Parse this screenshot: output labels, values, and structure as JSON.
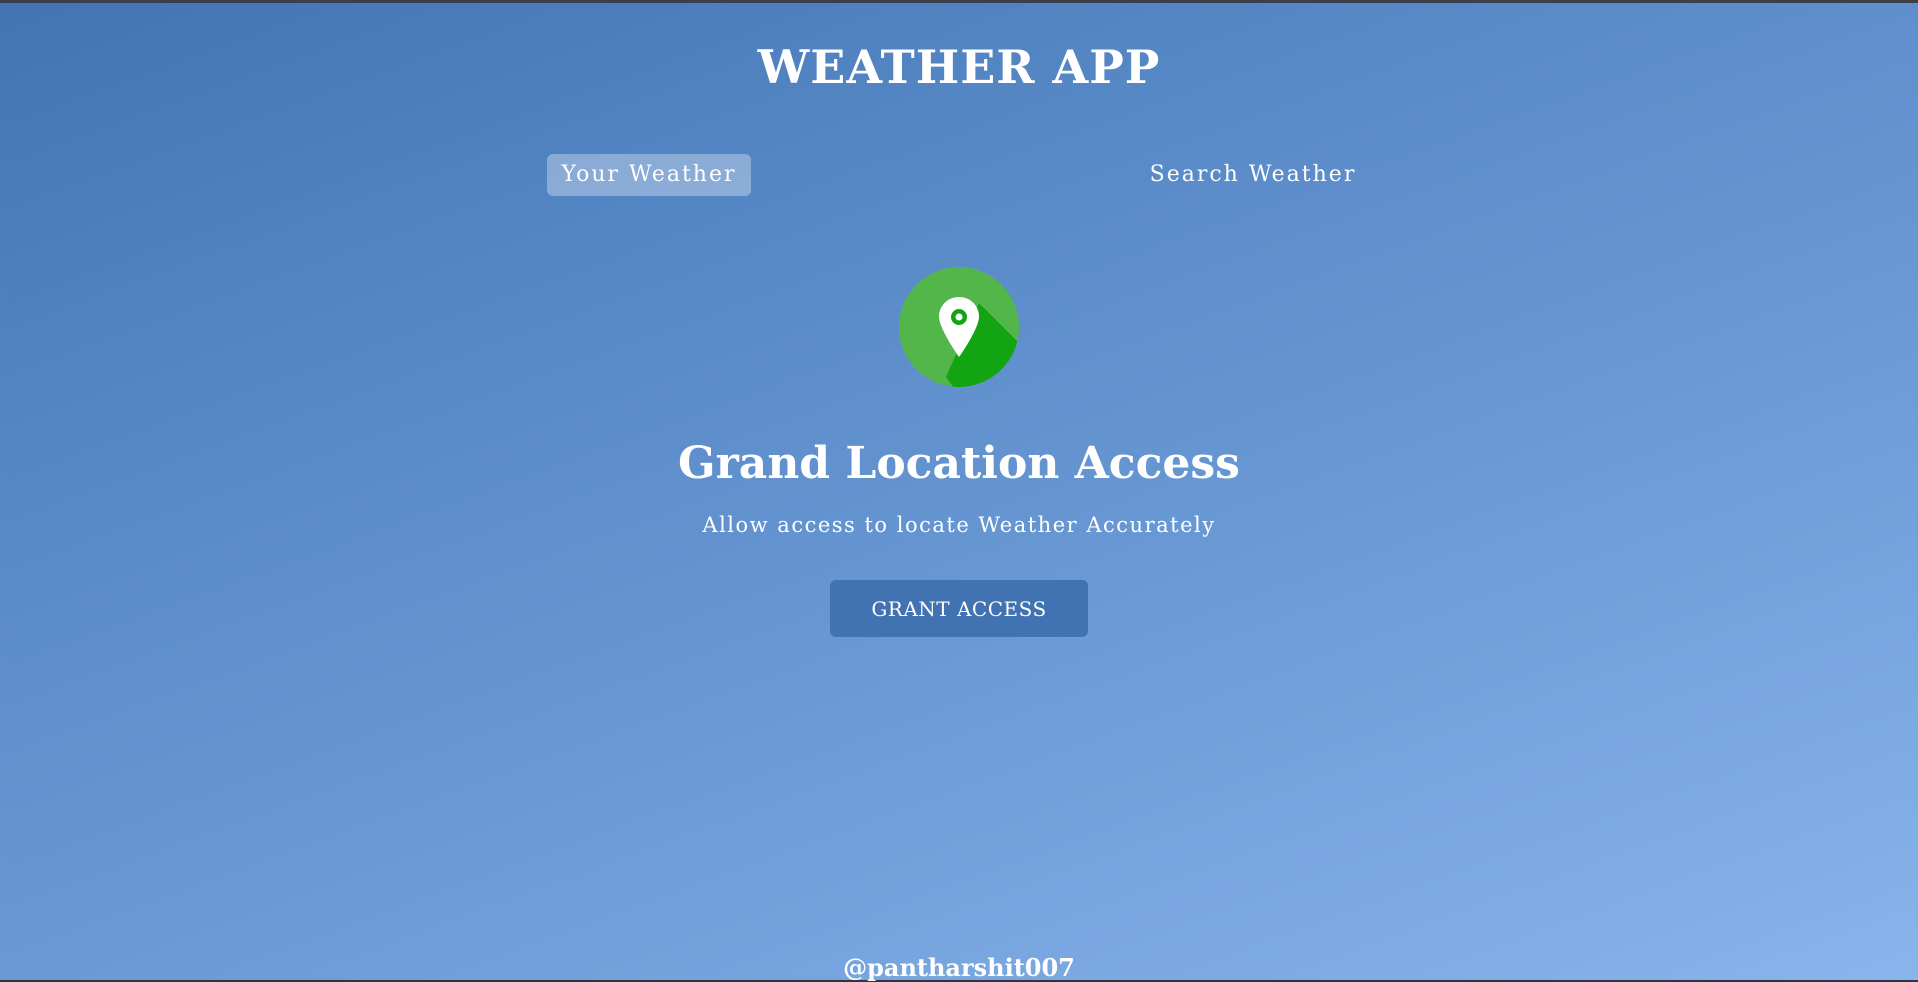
{
  "header": {
    "title": "WEATHER APP"
  },
  "tabs": [
    {
      "label": "Your Weather",
      "active": true
    },
    {
      "label": "Search Weather",
      "active": false
    }
  ],
  "grant_access": {
    "icon": "location-pin-icon",
    "icon_colors": {
      "circle": "#52b64a",
      "shadow": "#12a412",
      "pin": "#ffffff",
      "dot": "#12a412"
    },
    "title": "Grand Location Access",
    "subtitle": "Allow access to locate Weather Accurately",
    "button_label": "GRANT ACCESS"
  },
  "footer": {
    "handle": "@pantharshit007"
  }
}
